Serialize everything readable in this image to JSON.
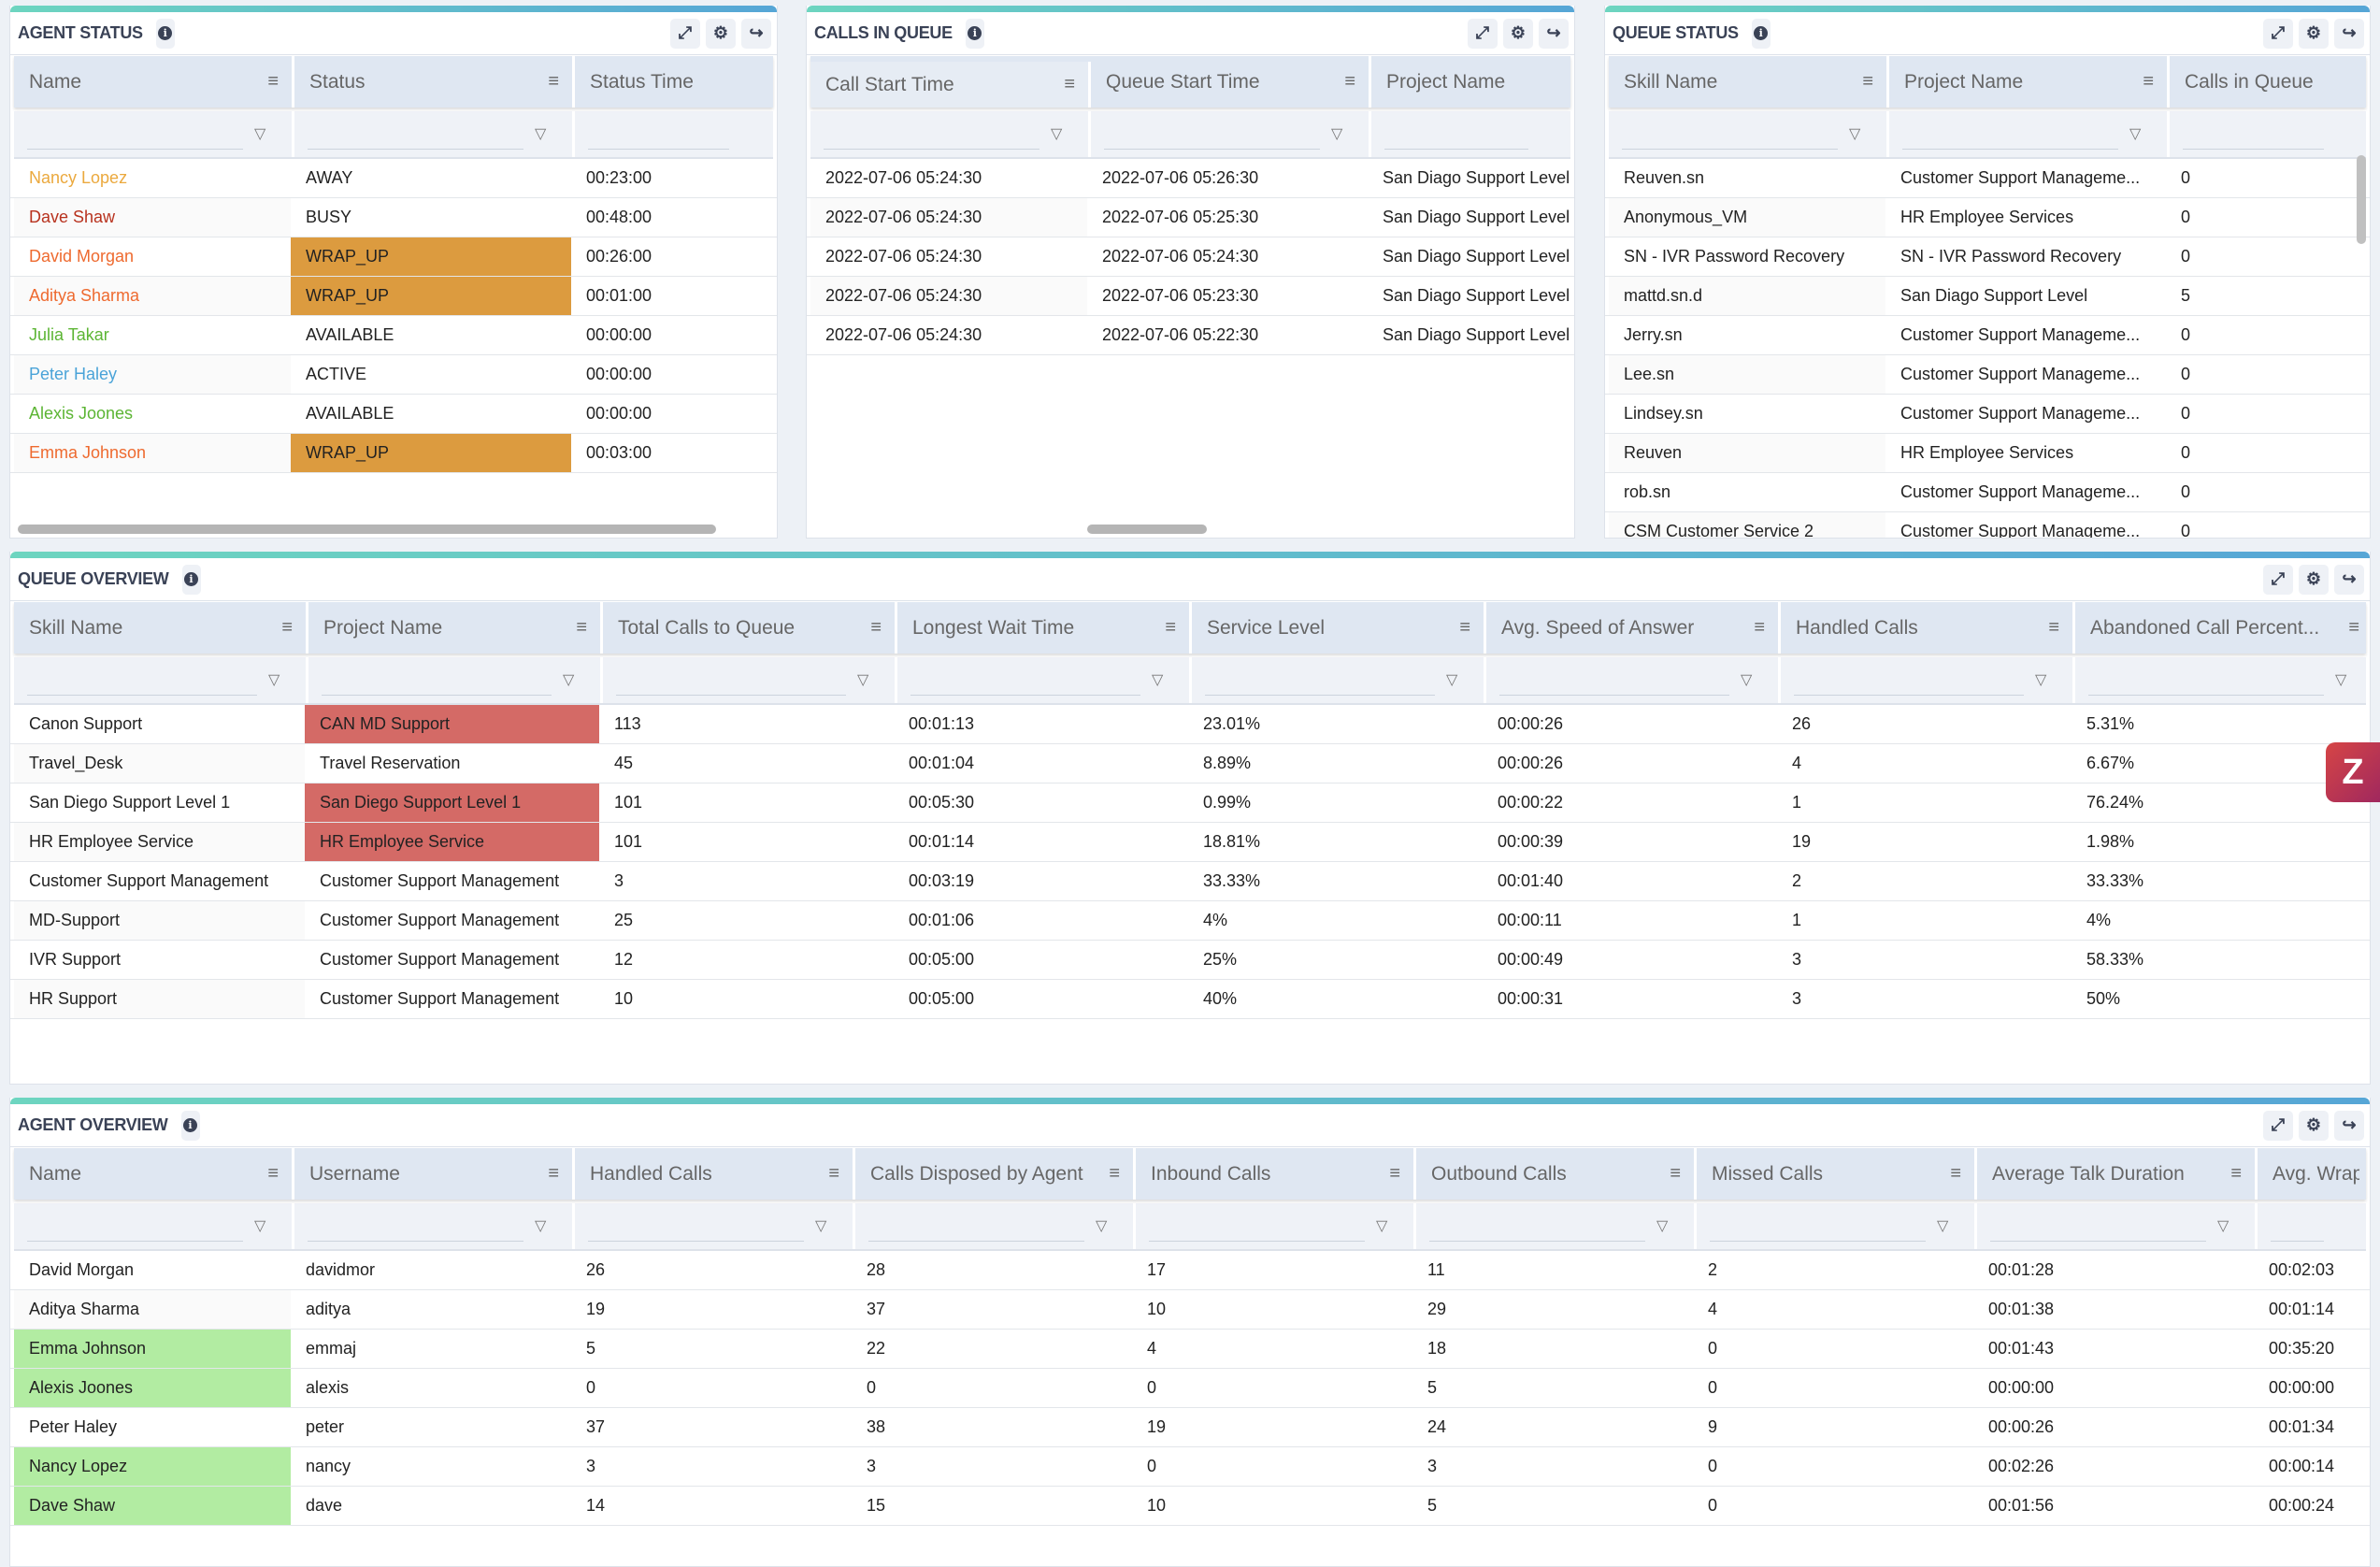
{
  "tools": {
    "expand_icon": "expand-icon",
    "settings_icon": "gear-icon",
    "share_icon": "share-icon",
    "info_icon": "i"
  },
  "colors": {
    "wrap_up": "#dc9b3f",
    "alert_red": "#d46a66",
    "available_green": "#b2eca2",
    "name_away": "#eba93e",
    "name_busy": "#b8321e",
    "name_wrapup": "#ee6a2f",
    "name_available": "#5cb534",
    "name_active": "#4aa3d8"
  },
  "panels": [
    {
      "id": "agent-status",
      "title": "AGENT STATUS",
      "columns": [
        "Name",
        "Status",
        "Status Time"
      ],
      "filters": [
        true,
        true,
        false
      ],
      "rows": [
        {
          "cells": [
            "Nancy Lopez",
            "AWAY",
            "00:23:00"
          ],
          "name_color": "#eba93e"
        },
        {
          "cells": [
            "Dave Shaw",
            "BUSY",
            "00:48:00"
          ],
          "name_color": "#b8321e"
        },
        {
          "cells": [
            "David Morgan",
            "WRAP_UP",
            "00:26:00"
          ],
          "name_color": "#ee6a2f",
          "highlight": {
            "1": "#dc9b3f"
          }
        },
        {
          "cells": [
            "Aditya Sharma",
            "WRAP_UP",
            "00:01:00"
          ],
          "name_color": "#ee6a2f",
          "highlight": {
            "1": "#dc9b3f"
          }
        },
        {
          "cells": [
            "Julia Takar",
            "AVAILABLE",
            "00:00:00"
          ],
          "name_color": "#5cb534"
        },
        {
          "cells": [
            "Peter Haley",
            "ACTIVE",
            "00:00:00"
          ],
          "name_color": "#4aa3d8"
        },
        {
          "cells": [
            "Alexis Joones",
            "AVAILABLE",
            "00:00:00"
          ],
          "name_color": "#5cb534"
        },
        {
          "cells": [
            "Emma Johnson",
            "WRAP_UP",
            "00:03:00"
          ],
          "name_color": "#ee6a2f",
          "highlight": {
            "1": "#dc9b3f"
          }
        }
      ]
    },
    {
      "id": "calls-in-queue",
      "title": "CALLS IN QUEUE",
      "columns": [
        "Call Start Time",
        "Queue Start Time",
        "Project Name"
      ],
      "filters": [
        true,
        true,
        false
      ],
      "rows": [
        {
          "cells": [
            "2022-07-06 05:24:30",
            "2022-07-06 05:26:30",
            "San Diago Support Level"
          ]
        },
        {
          "cells": [
            "2022-07-06 05:24:30",
            "2022-07-06 05:25:30",
            "San Diago Support Level"
          ]
        },
        {
          "cells": [
            "2022-07-06 05:24:30",
            "2022-07-06 05:24:30",
            "San Diago Support Level"
          ]
        },
        {
          "cells": [
            "2022-07-06 05:24:30",
            "2022-07-06 05:23:30",
            "San Diago Support Level"
          ]
        },
        {
          "cells": [
            "2022-07-06 05:24:30",
            "2022-07-06 05:22:30",
            "San Diago Support Level"
          ]
        }
      ]
    },
    {
      "id": "queue-status",
      "title": "QUEUE STATUS",
      "columns": [
        "Skill Name",
        "Project Name",
        "Calls in Queue"
      ],
      "filters": [
        true,
        true,
        false
      ],
      "rows": [
        {
          "cells": [
            "Reuven.sn",
            "Customer Support Manageme...",
            "0"
          ]
        },
        {
          "cells": [
            "Anonymous_VM",
            "HR Employee Services",
            "0"
          ]
        },
        {
          "cells": [
            "SN - IVR Password Recovery",
            "SN - IVR Password Recovery",
            "0"
          ]
        },
        {
          "cells": [
            "mattd.sn.d",
            "San Diago Support Level",
            "5"
          ]
        },
        {
          "cells": [
            "Jerry.sn",
            "Customer Support Manageme...",
            "0"
          ]
        },
        {
          "cells": [
            "Lee.sn",
            "Customer Support Manageme...",
            "0"
          ]
        },
        {
          "cells": [
            "Lindsey.sn",
            "Customer Support Manageme...",
            "0"
          ]
        },
        {
          "cells": [
            "Reuven",
            "HR Employee Services",
            "0"
          ]
        },
        {
          "cells": [
            "rob.sn",
            "Customer Support Manageme...",
            "0"
          ]
        },
        {
          "cells": [
            "CSM Customer Service 2",
            "Customer Support Manageme...",
            "0"
          ]
        }
      ]
    },
    {
      "id": "queue-overview",
      "title": "QUEUE OVERVIEW",
      "columns": [
        "Skill Name",
        "Project Name",
        "Total Calls to Queue",
        "Longest Wait Time",
        "Service Level",
        "Avg. Speed of Answer",
        "Handled Calls",
        "Abandoned Call Percent..."
      ],
      "filters": [
        true,
        true,
        true,
        true,
        true,
        true,
        true,
        true
      ],
      "rows": [
        {
          "cells": [
            "Canon Support",
            "CAN MD Support",
            "113",
            "00:01:13",
            "23.01%",
            "00:00:26",
            "26",
            "5.31%"
          ],
          "highlight": {
            "1": "#d46a66"
          }
        },
        {
          "cells": [
            "Travel_Desk",
            "Travel Reservation",
            "45",
            "00:01:04",
            "8.89%",
            "00:00:26",
            "4",
            "6.67%"
          ]
        },
        {
          "cells": [
            "San Diego Support Level 1",
            "San Diego Support Level 1",
            "101",
            "00:05:30",
            "0.99%",
            "00:00:22",
            "1",
            "76.24%"
          ],
          "highlight": {
            "1": "#d46a66"
          }
        },
        {
          "cells": [
            "HR Employee Service",
            "HR Employee Service",
            "101",
            "00:01:14",
            "18.81%",
            "00:00:39",
            "19",
            "1.98%"
          ],
          "highlight": {
            "1": "#d46a66"
          }
        },
        {
          "cells": [
            "Customer Support Management",
            "Customer Support Management",
            "3",
            "00:03:19",
            "33.33%",
            "00:01:40",
            "2",
            "33.33%"
          ]
        },
        {
          "cells": [
            "MD-Support",
            "Customer Support Management",
            "25",
            "00:01:06",
            "4%",
            "00:00:11",
            "1",
            "4%"
          ]
        },
        {
          "cells": [
            "IVR Support",
            "Customer Support Management",
            "12",
            "00:05:00",
            "25%",
            "00:00:49",
            "3",
            "58.33%"
          ]
        },
        {
          "cells": [
            "HR Support",
            "Customer Support Management",
            "10",
            "00:05:00",
            "40%",
            "00:00:31",
            "3",
            "50%"
          ]
        }
      ]
    },
    {
      "id": "agent-overview",
      "title": "AGENT OVERVIEW",
      "columns": [
        "Name",
        "Username",
        "Handled Calls",
        "Calls Disposed by Agent",
        "Inbound Calls",
        "Outbound Calls",
        "Missed Calls",
        "Average Talk Duration",
        "Avg. Wrap-"
      ],
      "filters": [
        true,
        true,
        true,
        true,
        true,
        true,
        true,
        true,
        false
      ],
      "rows": [
        {
          "cells": [
            "David Morgan",
            "davidmor",
            "26",
            "28",
            "17",
            "11",
            "2",
            "00:01:28",
            "00:02:03"
          ]
        },
        {
          "cells": [
            "Aditya Sharma",
            "aditya",
            "19",
            "37",
            "10",
            "29",
            "4",
            "00:01:38",
            "00:01:14"
          ]
        },
        {
          "cells": [
            "Emma Johnson",
            "emmaj",
            "5",
            "22",
            "4",
            "18",
            "0",
            "00:01:43",
            "00:35:20"
          ],
          "highlight": {
            "0": "#b2eca2"
          }
        },
        {
          "cells": [
            "Alexis Joones",
            "alexis",
            "0",
            "0",
            "0",
            "5",
            "0",
            "00:00:00",
            "00:00:00"
          ],
          "highlight": {
            "0": "#b2eca2"
          }
        },
        {
          "cells": [
            "Peter Haley",
            "peter",
            "37",
            "38",
            "19",
            "24",
            "9",
            "00:00:26",
            "00:01:34"
          ]
        },
        {
          "cells": [
            "Nancy Lopez",
            "nancy",
            "3",
            "3",
            "0",
            "3",
            "0",
            "00:02:26",
            "00:00:14"
          ],
          "highlight": {
            "0": "#b2eca2"
          }
        },
        {
          "cells": [
            "Dave Shaw",
            "dave",
            "14",
            "15",
            "10",
            "5",
            "0",
            "00:01:56",
            "00:00:24"
          ],
          "highlight": {
            "0": "#b2eca2"
          }
        }
      ]
    }
  ]
}
